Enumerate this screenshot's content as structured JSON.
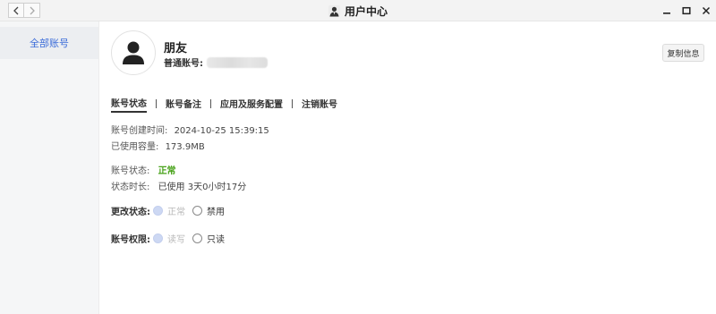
{
  "window": {
    "title": "用户中心"
  },
  "sidebar": {
    "items": [
      {
        "label": "全部账号",
        "active": true
      }
    ]
  },
  "user": {
    "name": "朋友",
    "account_label": "普通账号:",
    "copy_button": "复制信息"
  },
  "tabs": [
    {
      "label": "账号状态",
      "active": true
    },
    {
      "label": "账号备注"
    },
    {
      "label": "应用及服务配置"
    },
    {
      "label": "注销账号"
    }
  ],
  "details": {
    "created_label": "账号创建时间:",
    "created_value": "2024-10-25 15:39:15",
    "usage_label": "已使用容量:",
    "usage_value": "173.9MB",
    "status_label": "账号状态:",
    "status_value": "正常",
    "duration_label": "状态时长:",
    "duration_value": "已使用 3天0小时17分"
  },
  "change_status": {
    "label": "更改状态:",
    "options": [
      {
        "label": "正常",
        "checked": true,
        "disabled": true
      },
      {
        "label": "禁用",
        "checked": false
      }
    ]
  },
  "permissions": {
    "label": "账号权限:",
    "options": [
      {
        "label": "读写",
        "checked": true,
        "disabled": true
      },
      {
        "label": "只读",
        "checked": false
      }
    ]
  },
  "colors": {
    "accent": "#3b6cd9",
    "status_ok": "#49a31b",
    "radio_checked": "#cdd8f3"
  }
}
